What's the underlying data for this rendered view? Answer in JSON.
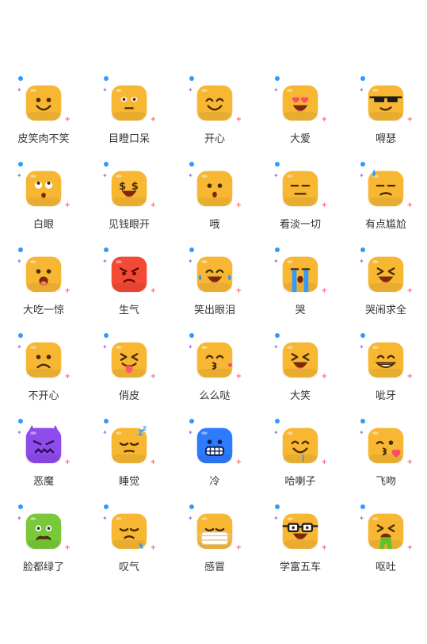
{
  "colors": {
    "yellow_face": "#F7B733",
    "yellow_shade": "#EE9F1E",
    "red_face": "#F24A35",
    "purple_face": "#8F4BEB",
    "blue_face": "#2E7BFF",
    "green_face": "#7AC93A",
    "feature": "#4A2A05",
    "accent_blue": "#2F9BFF",
    "accent_purple": "#9A7BE6",
    "accent_red": "#FF5A6A"
  },
  "emojis": [
    {
      "label": "皮笑肉不笑",
      "icon": "grimace-smile-icon",
      "face": "yellow"
    },
    {
      "label": "目瞪口呆",
      "icon": "stunned-icon",
      "face": "yellow"
    },
    {
      "label": "开心",
      "icon": "happy-icon",
      "face": "yellow"
    },
    {
      "label": "大爱",
      "icon": "heart-eyes-icon",
      "face": "yellow"
    },
    {
      "label": "嘚瑟",
      "icon": "sunglasses-icon",
      "face": "yellow"
    },
    {
      "label": "白眼",
      "icon": "eye-roll-icon",
      "face": "yellow"
    },
    {
      "label": "见钱眼开",
      "icon": "money-eyes-icon",
      "face": "yellow"
    },
    {
      "label": "哦",
      "icon": "oh-icon",
      "face": "yellow"
    },
    {
      "label": "看淡一切",
      "icon": "expressionless-icon",
      "face": "yellow"
    },
    {
      "label": "有点尴尬",
      "icon": "awkward-sweat-icon",
      "face": "yellow"
    },
    {
      "label": "大吃一惊",
      "icon": "shocked-icon",
      "face": "yellow"
    },
    {
      "label": "生气",
      "icon": "angry-icon",
      "face": "red"
    },
    {
      "label": "笑出眼泪",
      "icon": "tears-of-joy-icon",
      "face": "yellow"
    },
    {
      "label": "哭",
      "icon": "crying-icon",
      "face": "yellow"
    },
    {
      "label": "哭闹求全",
      "icon": "wailing-icon",
      "face": "yellow"
    },
    {
      "label": "不开心",
      "icon": "unhappy-icon",
      "face": "yellow"
    },
    {
      "label": "俏皮",
      "icon": "tongue-out-icon",
      "face": "yellow"
    },
    {
      "label": "么么哒",
      "icon": "kiss-icon",
      "face": "yellow"
    },
    {
      "label": "大笑",
      "icon": "laughing-icon",
      "face": "yellow"
    },
    {
      "label": "呲牙",
      "icon": "grin-teeth-icon",
      "face": "yellow"
    },
    {
      "label": "恶魔",
      "icon": "devil-icon",
      "face": "purple"
    },
    {
      "label": "睡觉",
      "icon": "sleeping-icon",
      "face": "yellow"
    },
    {
      "label": "冷",
      "icon": "cold-icon",
      "face": "blue"
    },
    {
      "label": "哈喇子",
      "icon": "drooling-icon",
      "face": "yellow"
    },
    {
      "label": "飞吻",
      "icon": "blow-kiss-icon",
      "face": "yellow"
    },
    {
      "label": "脸都绿了",
      "icon": "nauseated-icon",
      "face": "green"
    },
    {
      "label": "叹气",
      "icon": "sigh-icon",
      "face": "yellow"
    },
    {
      "label": "感冒",
      "icon": "mask-icon",
      "face": "yellow"
    },
    {
      "label": "学富五车",
      "icon": "nerd-glasses-icon",
      "face": "yellow"
    },
    {
      "label": "呕吐",
      "icon": "vomit-icon",
      "face": "yellow"
    }
  ]
}
